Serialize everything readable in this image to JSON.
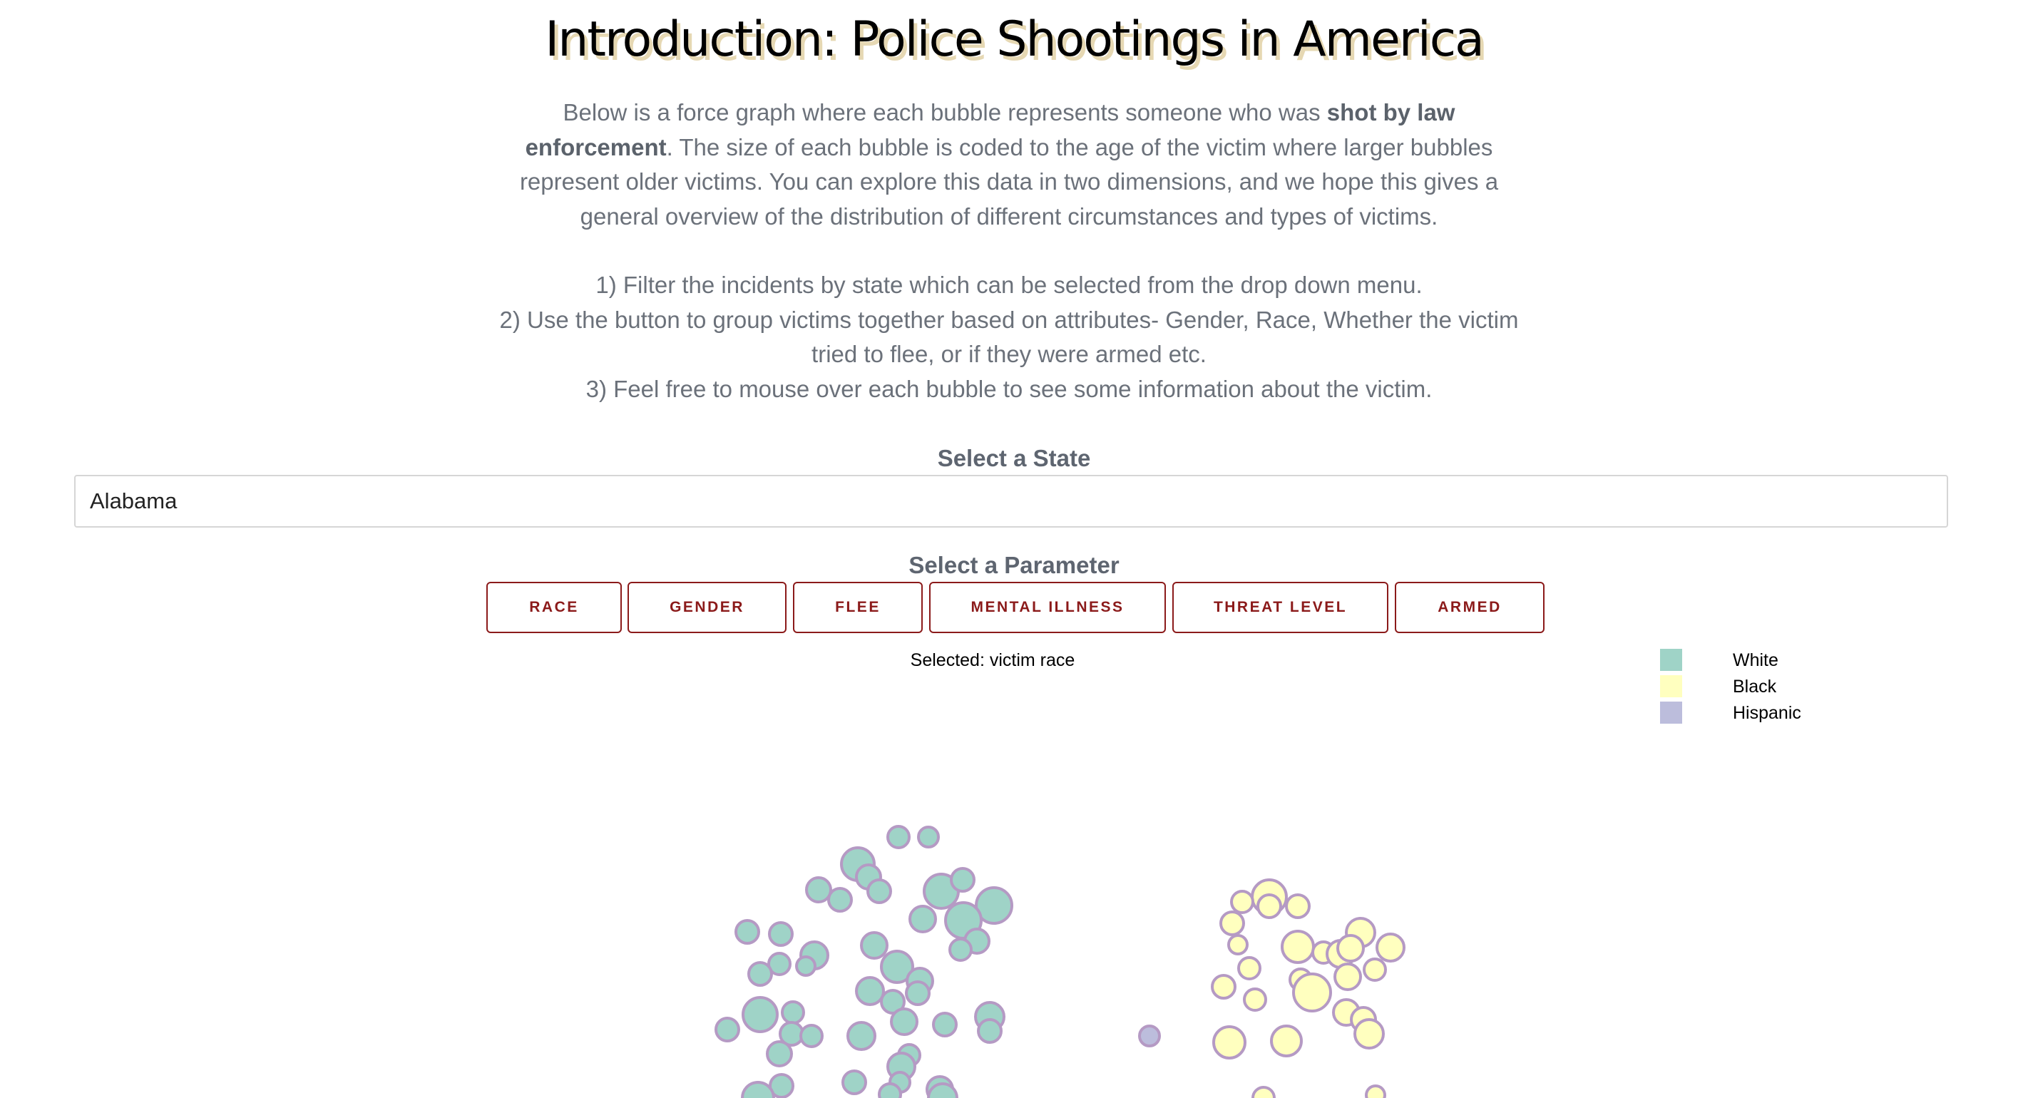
{
  "title": "Introduction: Police Shootings in America",
  "intro": {
    "para1_part1": "Below is a force graph where each bubble represents someone who was ",
    "para1_bold": "shot by law enforcement",
    "para1_part2": ". The size of each bubble is coded to the age of the victim where larger bubbles represent older victims. You can explore this data in two dimensions, and we hope this gives a general overview of the distribution of different circumstances and types of victims.",
    "step1": "1) Filter the incidents by state which can be selected from the drop down menu.",
    "step2": "2) Use the button to group victims together based on attributes- Gender, Race, Whether the victim tried to flee, or if they were armed etc.",
    "step3": "3) Feel free to mouse over each bubble to see some information about the victim."
  },
  "state_select": {
    "label": "Select a State",
    "value": "Alabama"
  },
  "parameter": {
    "label": "Select a Parameter",
    "buttons": [
      "RACE",
      "GENDER",
      "FLEE",
      "MENTAL ILLNESS",
      "THREAT LEVEL",
      "ARMED"
    ],
    "selected_text": "Selected: victim race"
  },
  "legend": [
    {
      "label": "White",
      "color": "#9fd3c7"
    },
    {
      "label": "Black",
      "color": "#ffffbf"
    },
    {
      "label": "Hispanic",
      "color": "#bcbddc"
    }
  ],
  "colors": {
    "bubble_stroke": "#b59ac4",
    "button_accent": "#8b1a1a"
  }
}
